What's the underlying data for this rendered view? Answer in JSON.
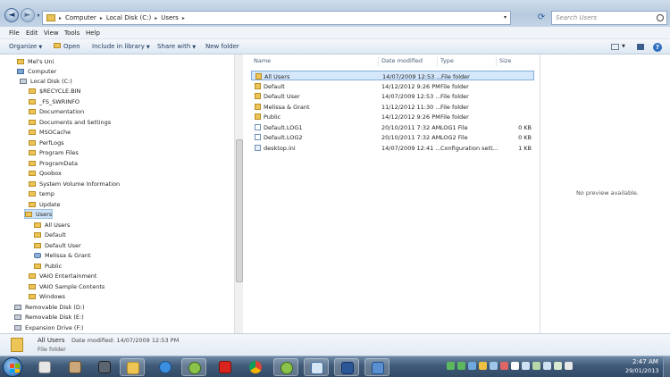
{
  "address": {
    "crumbs": [
      "Computer",
      "Local Disk (C:)",
      "Users"
    ],
    "search_placeholder": "Search Users"
  },
  "menu": [
    "File",
    "Edit",
    "View",
    "Tools",
    "Help"
  ],
  "toolbar": {
    "organize": "Organize",
    "open": "Open",
    "include": "Include in library",
    "share": "Share with",
    "new_folder": "New folder"
  },
  "nav": [
    {
      "label": "Mel's Uni",
      "icon": "folder"
    },
    {
      "label": "Computer",
      "icon": "pc"
    },
    {
      "label": "Local Disk (C:)",
      "icon": "drive"
    },
    {
      "label": "$RECYCLE.BIN",
      "icon": "folder"
    },
    {
      "label": "_FS_SWRINFO",
      "icon": "folder"
    },
    {
      "label": "Documentation",
      "icon": "folder"
    },
    {
      "label": "Documents and Settings",
      "icon": "folder"
    },
    {
      "label": "MSOCache",
      "icon": "folder"
    },
    {
      "label": "PerfLogs",
      "icon": "folder"
    },
    {
      "label": "Program Files",
      "icon": "folder"
    },
    {
      "label": "ProgramData",
      "icon": "folder"
    },
    {
      "label": "Qoobox",
      "icon": "folder"
    },
    {
      "label": "System Volume Information",
      "icon": "folder"
    },
    {
      "label": "temp",
      "icon": "folder"
    },
    {
      "label": "Update",
      "icon": "folder"
    },
    {
      "label": "Users",
      "icon": "folder"
    },
    {
      "label": "All Users",
      "icon": "folder"
    },
    {
      "label": "Default",
      "icon": "folder"
    },
    {
      "label": "Default User",
      "icon": "folder"
    },
    {
      "label": "Melissa & Grant",
      "icon": "user"
    },
    {
      "label": "Public",
      "icon": "folder"
    },
    {
      "label": "VAIO Entertainment",
      "icon": "folder"
    },
    {
      "label": "VAIO Sample Contents",
      "icon": "folder"
    },
    {
      "label": "Windows",
      "icon": "folder"
    },
    {
      "label": "Removable Disk (D:)",
      "icon": "drive"
    },
    {
      "label": "Removable Disk (E:)",
      "icon": "drive"
    },
    {
      "label": "Expansion Drive (F:)",
      "icon": "drive"
    }
  ],
  "columns": {
    "name": "Name",
    "date": "Date modified",
    "type": "Type",
    "size": "Size"
  },
  "files": [
    {
      "name": "All Users",
      "date": "14/07/2009 12:53 ...",
      "type": "File folder",
      "size": "",
      "icon": "lock"
    },
    {
      "name": "Default",
      "date": "14/12/2012 9:26 PM",
      "type": "File folder",
      "size": "",
      "icon": "folder"
    },
    {
      "name": "Default User",
      "date": "14/07/2009 12:53 ...",
      "type": "File folder",
      "size": "",
      "icon": "lock"
    },
    {
      "name": "Melissa & Grant",
      "date": "11/12/2012 11:30 ...",
      "type": "File folder",
      "size": "",
      "icon": "folder"
    },
    {
      "name": "Public",
      "date": "14/12/2012 9:26 PM",
      "type": "File folder",
      "size": "",
      "icon": "folder"
    },
    {
      "name": "Default.LOG1",
      "date": "20/10/2011 7:32 AM",
      "type": "LOG1 File",
      "size": "0 KB",
      "icon": "doc"
    },
    {
      "name": "Default.LOG2",
      "date": "20/10/2011 7:32 AM",
      "type": "LOG2 File",
      "size": "0 KB",
      "icon": "doc"
    },
    {
      "name": "desktop.ini",
      "date": "14/07/2009 12:41 ...",
      "type": "Configuration sett...",
      "size": "1 KB",
      "icon": "ini"
    }
  ],
  "preview": {
    "empty": "No preview available."
  },
  "details": {
    "name": "All Users",
    "meta": "Date modified: 14/07/2009 12:53 PM",
    "type": "File folder"
  },
  "clock": {
    "time": "2:47 AM",
    "date": "29/01/2013"
  },
  "colors": {
    "selection": "#cfe3f7",
    "folder": "#ecc556",
    "taskbar": "#3f5a78",
    "accent": "#2e6fc2"
  }
}
